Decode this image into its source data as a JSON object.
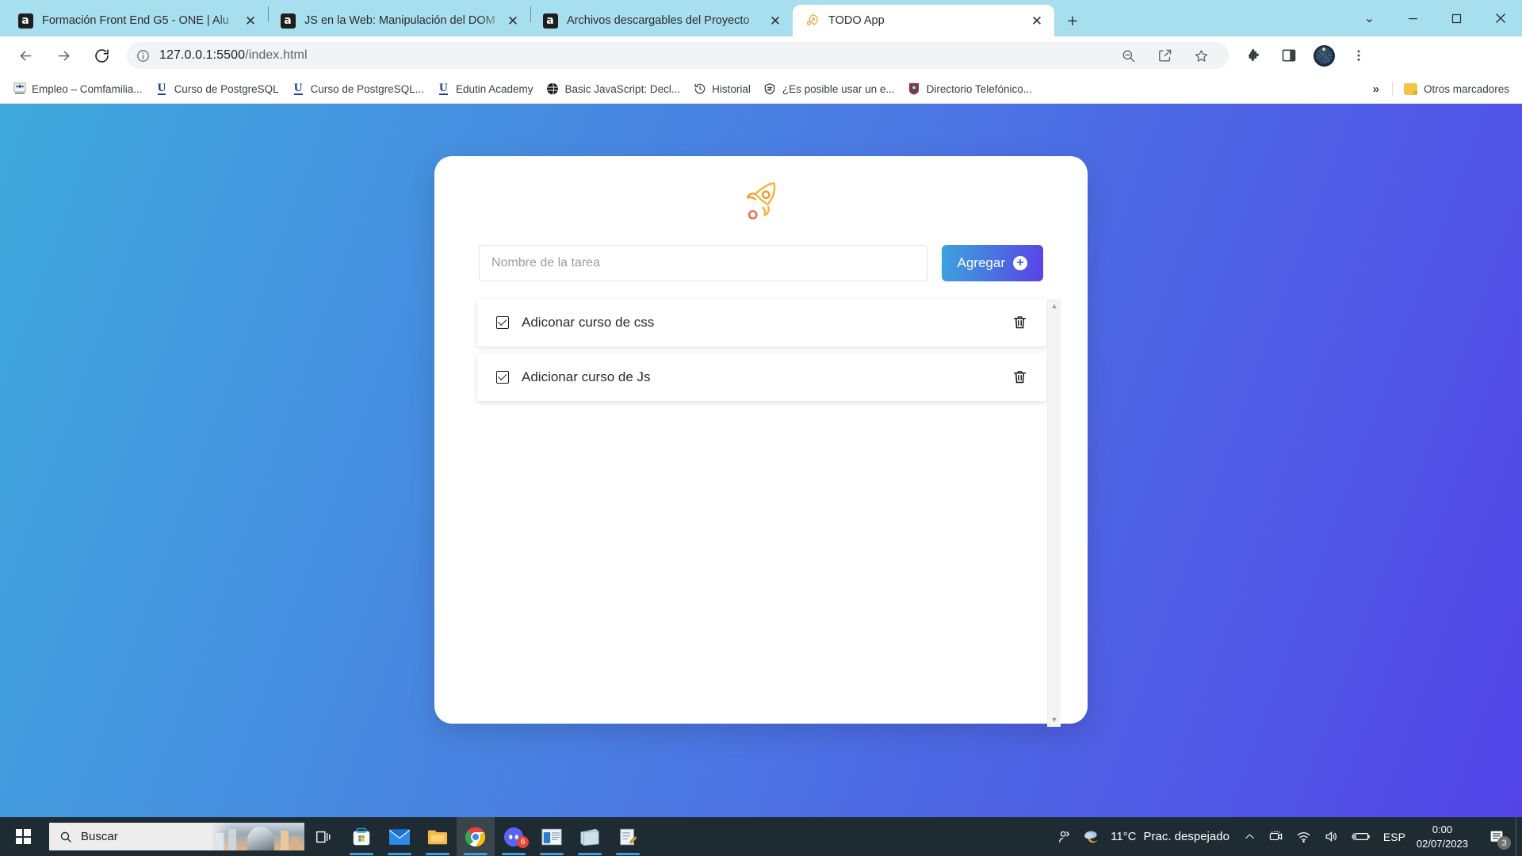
{
  "browser": {
    "tabs": [
      {
        "title": "Formación Front End G5 - ONE | Alu",
        "favicon": "alura-icon",
        "active": false,
        "close_label": "✕"
      },
      {
        "title": "JS en la Web: Manipulación del DOM",
        "favicon": "alura-icon",
        "active": false,
        "close_label": "✕"
      },
      {
        "title": "Archivos descargables del Proyecto",
        "favicon": "alura-icon",
        "active": false,
        "close_label": "✕"
      },
      {
        "title": "TODO App",
        "favicon": "rocket-icon",
        "active": true,
        "close_label": "✕"
      }
    ],
    "new_tab_label": "+",
    "window_controls": {
      "minimize": "—",
      "maximize": "▢",
      "close": "✕",
      "collapse": "⌄"
    },
    "nav": {
      "back": "←",
      "forward": "→",
      "reload": "⟳"
    },
    "omnibox": {
      "site_info_icon": "info-circle-icon",
      "url_host": "127.0.0.1:5500",
      "url_path": "/index.html",
      "zoom_icon": "zoom-out-icon",
      "share_icon": "share-icon",
      "bookmark_icon": "star-icon"
    },
    "toolbar_icons": {
      "extensions": "puzzle-icon",
      "side_panel": "side-panel-icon",
      "profile": "avatar-icon",
      "menu": "three-dot-menu-icon"
    },
    "bookmarks": [
      {
        "label": "Empleo – Comfamilia...",
        "icon": "comfamiliar-shield-icon"
      },
      {
        "label": "Curso de PostgreSQL",
        "icon": "udemy-u-icon"
      },
      {
        "label": "Curso de PostgreSQL...",
        "icon": "udemy-u-icon"
      },
      {
        "label": "Edutin Academy",
        "icon": "udemy-u-icon"
      },
      {
        "label": "Basic JavaScript: Decl...",
        "icon": "globe-icon"
      },
      {
        "label": "Historial",
        "icon": "history-clock-icon"
      },
      {
        "label": "¿Es posible usar un e...",
        "icon": "shield-icon"
      },
      {
        "label": "Directorio Telefónico...",
        "icon": "crest-icon"
      }
    ],
    "bookmarks_overflow_label": "»",
    "other_bookmarks_label": "Otros marcadores"
  },
  "app": {
    "logo_icon": "rocket-icon",
    "input": {
      "placeholder": "Nombre de la tarea",
      "value": ""
    },
    "add_button": {
      "label": "Agregar",
      "icon": "plus-circle-icon"
    },
    "scrollbar": {
      "up_arrow": "▲",
      "down_arrow": "▼"
    },
    "tasks": [
      {
        "name": "Adiconar curso de css",
        "checked": true,
        "delete_icon": "trash-icon"
      },
      {
        "name": "Adicionar curso de Js",
        "checked": true,
        "delete_icon": "trash-icon"
      }
    ]
  },
  "taskbar": {
    "start_label": "start-windows-icon",
    "search": {
      "placeholder": "Buscar",
      "icon": "magnifier-icon"
    },
    "apps": [
      {
        "name": "task-view",
        "running": false
      },
      {
        "name": "microsoft-store",
        "running": true
      },
      {
        "name": "mail",
        "running": true
      },
      {
        "name": "file-explorer",
        "running": true
      },
      {
        "name": "google-chrome",
        "running": true,
        "active": true
      },
      {
        "name": "discord",
        "running": true,
        "badge": "6"
      },
      {
        "name": "window-app",
        "running": true
      },
      {
        "name": "notepad",
        "running": true
      },
      {
        "name": "text-editor",
        "running": true
      }
    ],
    "tray": {
      "people_icon": "people-icon",
      "weather": {
        "temperature": "11°C",
        "condition": "Prac. despejado",
        "icon": "partly-cloudy-icon"
      },
      "overflow_icon": "chevron-up-icon",
      "meet_icon": "camera-icon",
      "network_icon": "wifi-icon",
      "volume_icon": "speaker-icon",
      "battery_icon": "battery-charging-icon",
      "language": "ESP",
      "time": "0:00",
      "date": "02/07/2023",
      "notifications_icon": "notifications-icon",
      "notifications_count": "3"
    }
  },
  "colors": {
    "page_gradient_start": "#3fa9dc",
    "page_gradient_end": "#5344e8",
    "tabstrip": "#a8dfee",
    "accent_button_start": "#3ea3e0",
    "accent_button_end": "#5b41e8",
    "rocket_orange": "#f2a43a",
    "taskbar": "#1f2b33"
  }
}
